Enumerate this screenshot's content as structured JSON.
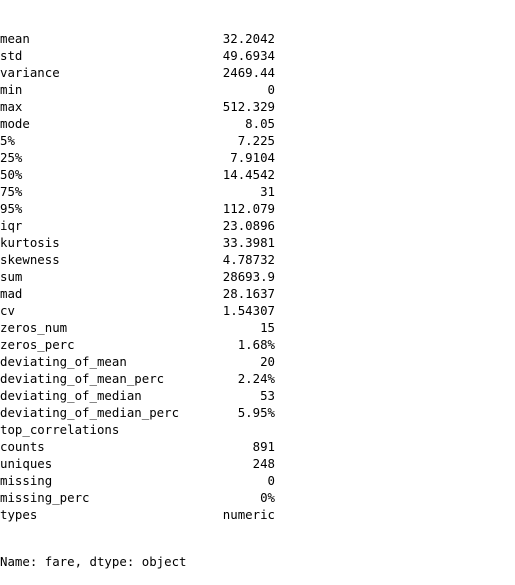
{
  "rows": [
    {
      "key": "mean",
      "value": "32.2042"
    },
    {
      "key": "std",
      "value": "49.6934"
    },
    {
      "key": "variance",
      "value": "2469.44"
    },
    {
      "key": "min",
      "value": "0"
    },
    {
      "key": "max",
      "value": "512.329"
    },
    {
      "key": "mode",
      "value": "8.05"
    },
    {
      "key": "5%",
      "value": "7.225"
    },
    {
      "key": "25%",
      "value": "7.9104"
    },
    {
      "key": "50%",
      "value": "14.4542"
    },
    {
      "key": "75%",
      "value": "31"
    },
    {
      "key": "95%",
      "value": "112.079"
    },
    {
      "key": "iqr",
      "value": "23.0896"
    },
    {
      "key": "kurtosis",
      "value": "33.3981"
    },
    {
      "key": "skewness",
      "value": "4.78732"
    },
    {
      "key": "sum",
      "value": "28693.9"
    },
    {
      "key": "mad",
      "value": "28.1637"
    },
    {
      "key": "cv",
      "value": "1.54307"
    },
    {
      "key": "zeros_num",
      "value": "15"
    },
    {
      "key": "zeros_perc",
      "value": "1.68%"
    },
    {
      "key": "deviating_of_mean",
      "value": "20"
    },
    {
      "key": "deviating_of_mean_perc",
      "value": "2.24%"
    },
    {
      "key": "deviating_of_median",
      "value": "53"
    },
    {
      "key": "deviating_of_median_perc",
      "value": "5.95%"
    },
    {
      "key": "top_correlations",
      "value": ""
    },
    {
      "key": "counts",
      "value": "891"
    },
    {
      "key": "uniques",
      "value": "248"
    },
    {
      "key": "missing",
      "value": "0"
    },
    {
      "key": "missing_perc",
      "value": "0%"
    },
    {
      "key": "types",
      "value": "numeric"
    }
  ],
  "footer": "Name: fare, dtype: object"
}
